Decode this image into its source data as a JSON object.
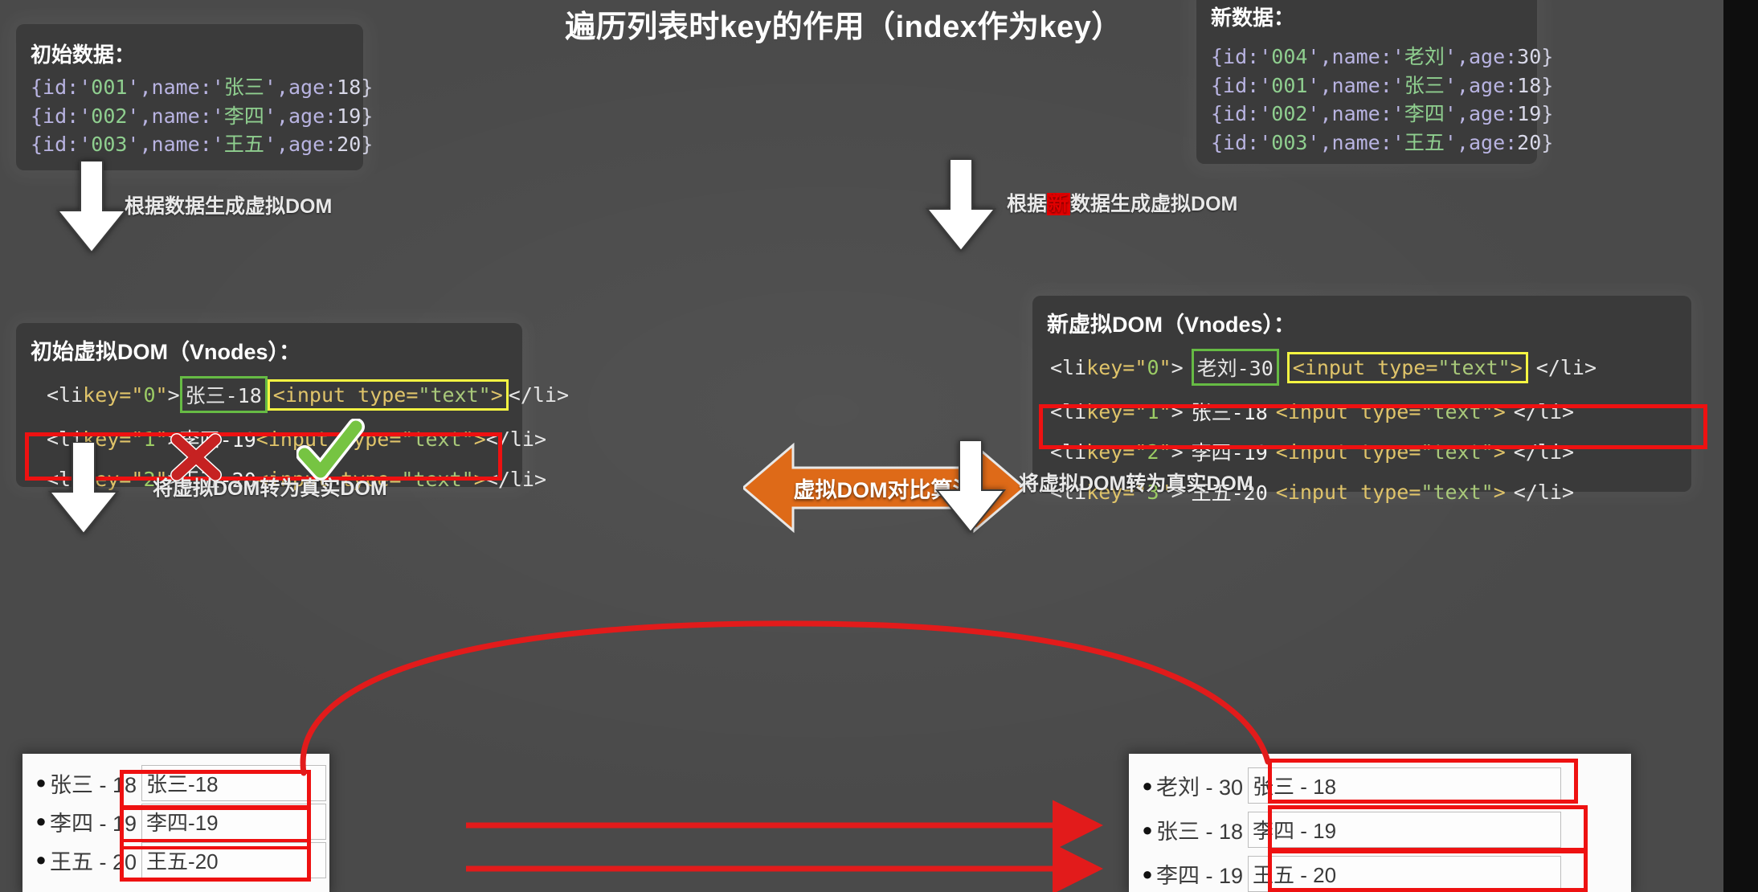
{
  "slide": {
    "title": "遍历列表时key的作用（index作为key）",
    "background_color": "#4a4a4a",
    "accent_red": "#ee1111",
    "accent_orange": "#de6a18",
    "accent_green": "#66bb44",
    "accent_yellow": "#f5f542"
  },
  "initial_data": {
    "heading": "初始数据：",
    "rows": [
      {
        "id": "001",
        "name": "张三",
        "age": "18"
      },
      {
        "id": "002",
        "name": "李四",
        "age": "19"
      },
      {
        "id": "003",
        "name": "王五",
        "age": "20"
      }
    ]
  },
  "new_data": {
    "heading": "新数据：",
    "rows": [
      {
        "id": "004",
        "name": "老刘",
        "age": "30"
      },
      {
        "id": "001",
        "name": "张三",
        "age": "18"
      },
      {
        "id": "002",
        "name": "李四",
        "age": "19"
      },
      {
        "id": "003",
        "name": "王五",
        "age": "20"
      }
    ]
  },
  "labels": {
    "gen_vdom_left": "根据数据生成虚拟DOM",
    "gen_vdom_right_prefix": "根据",
    "gen_vdom_right_redacted": "新",
    "gen_vdom_right_suffix": "数据生成虚拟DOM",
    "to_real_dom_left": "将虚拟DOM转为真实DOM",
    "to_real_dom_right": "将虚拟DOM转为真实DOM",
    "diff_algorithm": "虚拟DOM对比算法"
  },
  "old_vnodes": {
    "heading": "初始虚拟DOM（Vnodes）：",
    "rows": [
      {
        "key": "0",
        "text": "张三-18",
        "input": "<input type=\"text\">",
        "close": "</li>",
        "marked": true,
        "mark_text": "x-mark",
        "mark_input": "check-mark"
      },
      {
        "key": "1",
        "text": "李四-19",
        "input": "<input type=\"text\">",
        "close": "</li>",
        "marked": false
      },
      {
        "key": "2",
        "text": "王五-20",
        "input": "<input type=\"text\">",
        "close": "</li>",
        "marked": false
      }
    ]
  },
  "new_vnodes": {
    "heading": "新虚拟DOM（Vnodes）：",
    "rows": [
      {
        "key": "0",
        "text": "老刘-30",
        "input": "<input type=\"text\">",
        "close": "</li>",
        "marked": true
      },
      {
        "key": "1",
        "text": "张三-18",
        "input": "<input type=\"text\">",
        "close": "</li>",
        "marked": false
      },
      {
        "key": "2",
        "text": "李四-19",
        "input": "<input type=\"text\">",
        "close": "</li>",
        "marked": false
      },
      {
        "key": "3",
        "text": "王五-20",
        "input": "<input type=\"text\">",
        "close": "</li>",
        "marked": false
      }
    ]
  },
  "old_real_dom": {
    "rows": [
      {
        "label": "张三 - 18",
        "input_value": "张三-18"
      },
      {
        "label": "李四 - 19",
        "input_value": "李四-19"
      },
      {
        "label": "王五 - 20",
        "input_value": "王五-20"
      }
    ]
  },
  "new_real_dom": {
    "rows": [
      {
        "label": "老刘 - 30",
        "input_value": "张三 - 18"
      },
      {
        "label": "张三 - 18",
        "input_value": "李四 - 19"
      },
      {
        "label": "李四 - 19",
        "input_value": "王五 - 20"
      }
    ]
  },
  "code_tokens": {
    "obj_open": "{id:'",
    "obj_mid1": "',name:'",
    "obj_mid2": "',age:",
    "obj_close": "}",
    "li_open": "<li key=\"",
    "li_open_end": "\">",
    "li_close": "</li>",
    "input_tag": "<input type=\"text\">"
  }
}
